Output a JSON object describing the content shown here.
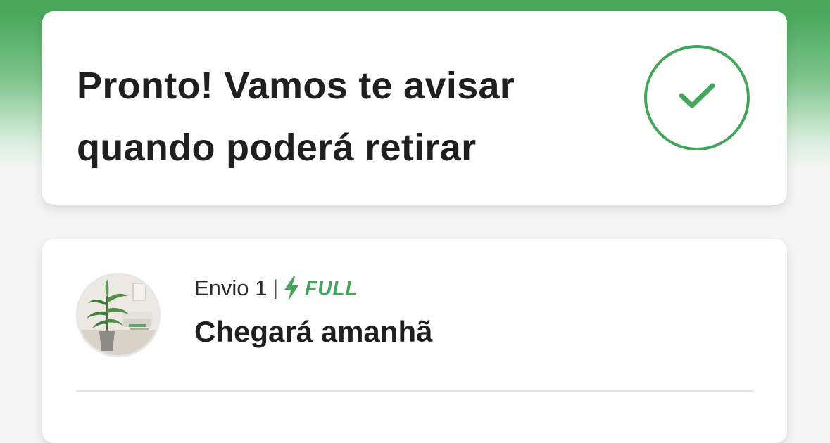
{
  "success": {
    "title": "Pronto! Vamos te avisar quando poderá retirar",
    "icon": "check-icon",
    "accent_color": "#43a55a"
  },
  "shipment": {
    "label": "Envio 1",
    "separator": "|",
    "badge_icon": "lightning-bolt-icon",
    "badge_label": "FULL",
    "badge_color": "#43a55a",
    "product_image": "product-thumbnail",
    "delivery_text": "Chegará amanhã"
  }
}
